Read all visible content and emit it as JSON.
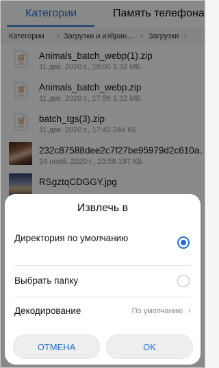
{
  "tabs": [
    {
      "label": "Категории",
      "active": true
    },
    {
      "label": "Память телефона",
      "active": false
    }
  ],
  "breadcrumb": [
    "Категории",
    "Загрузки и избран…",
    "Загрузки"
  ],
  "files": [
    {
      "name": "Animals_batch_webp(1).zip",
      "meta": "11 дек. 2020 г., 18:00 1,32 МБ",
      "icon": "zip-file-icon"
    },
    {
      "name": "Animals_batch_webp.zip",
      "meta": "11 дек. 2020 г., 17:56 1,32 МБ",
      "icon": "zip-file-icon"
    },
    {
      "name": "batch_tgs(3).zip",
      "meta": "11 дек. 2020 г., 17:42 244 КБ",
      "icon": "zip-file-icon"
    },
    {
      "name": "232c87588dee2c7f27be95979d2c610a…",
      "meta": "24 нояб. 2020 г., 23:58 197 КБ",
      "icon": "image-thumbnail"
    },
    {
      "name": "RSgztqCDGGY.jpg",
      "meta": "",
      "icon": "image-thumbnail"
    }
  ],
  "dialog": {
    "title": "Извлечь в",
    "options": [
      {
        "label": "Директория по умолчанию",
        "selected": true
      },
      {
        "label": "Выбрать папку",
        "selected": false
      }
    ],
    "decode": {
      "label": "Декодирование",
      "value": "По умолчанию"
    },
    "cancel_label": "ОТМЕНА",
    "ok_label": "OK"
  },
  "colors": {
    "accent": "#1f6fd1",
    "zip_icon": "#e08a2c"
  }
}
